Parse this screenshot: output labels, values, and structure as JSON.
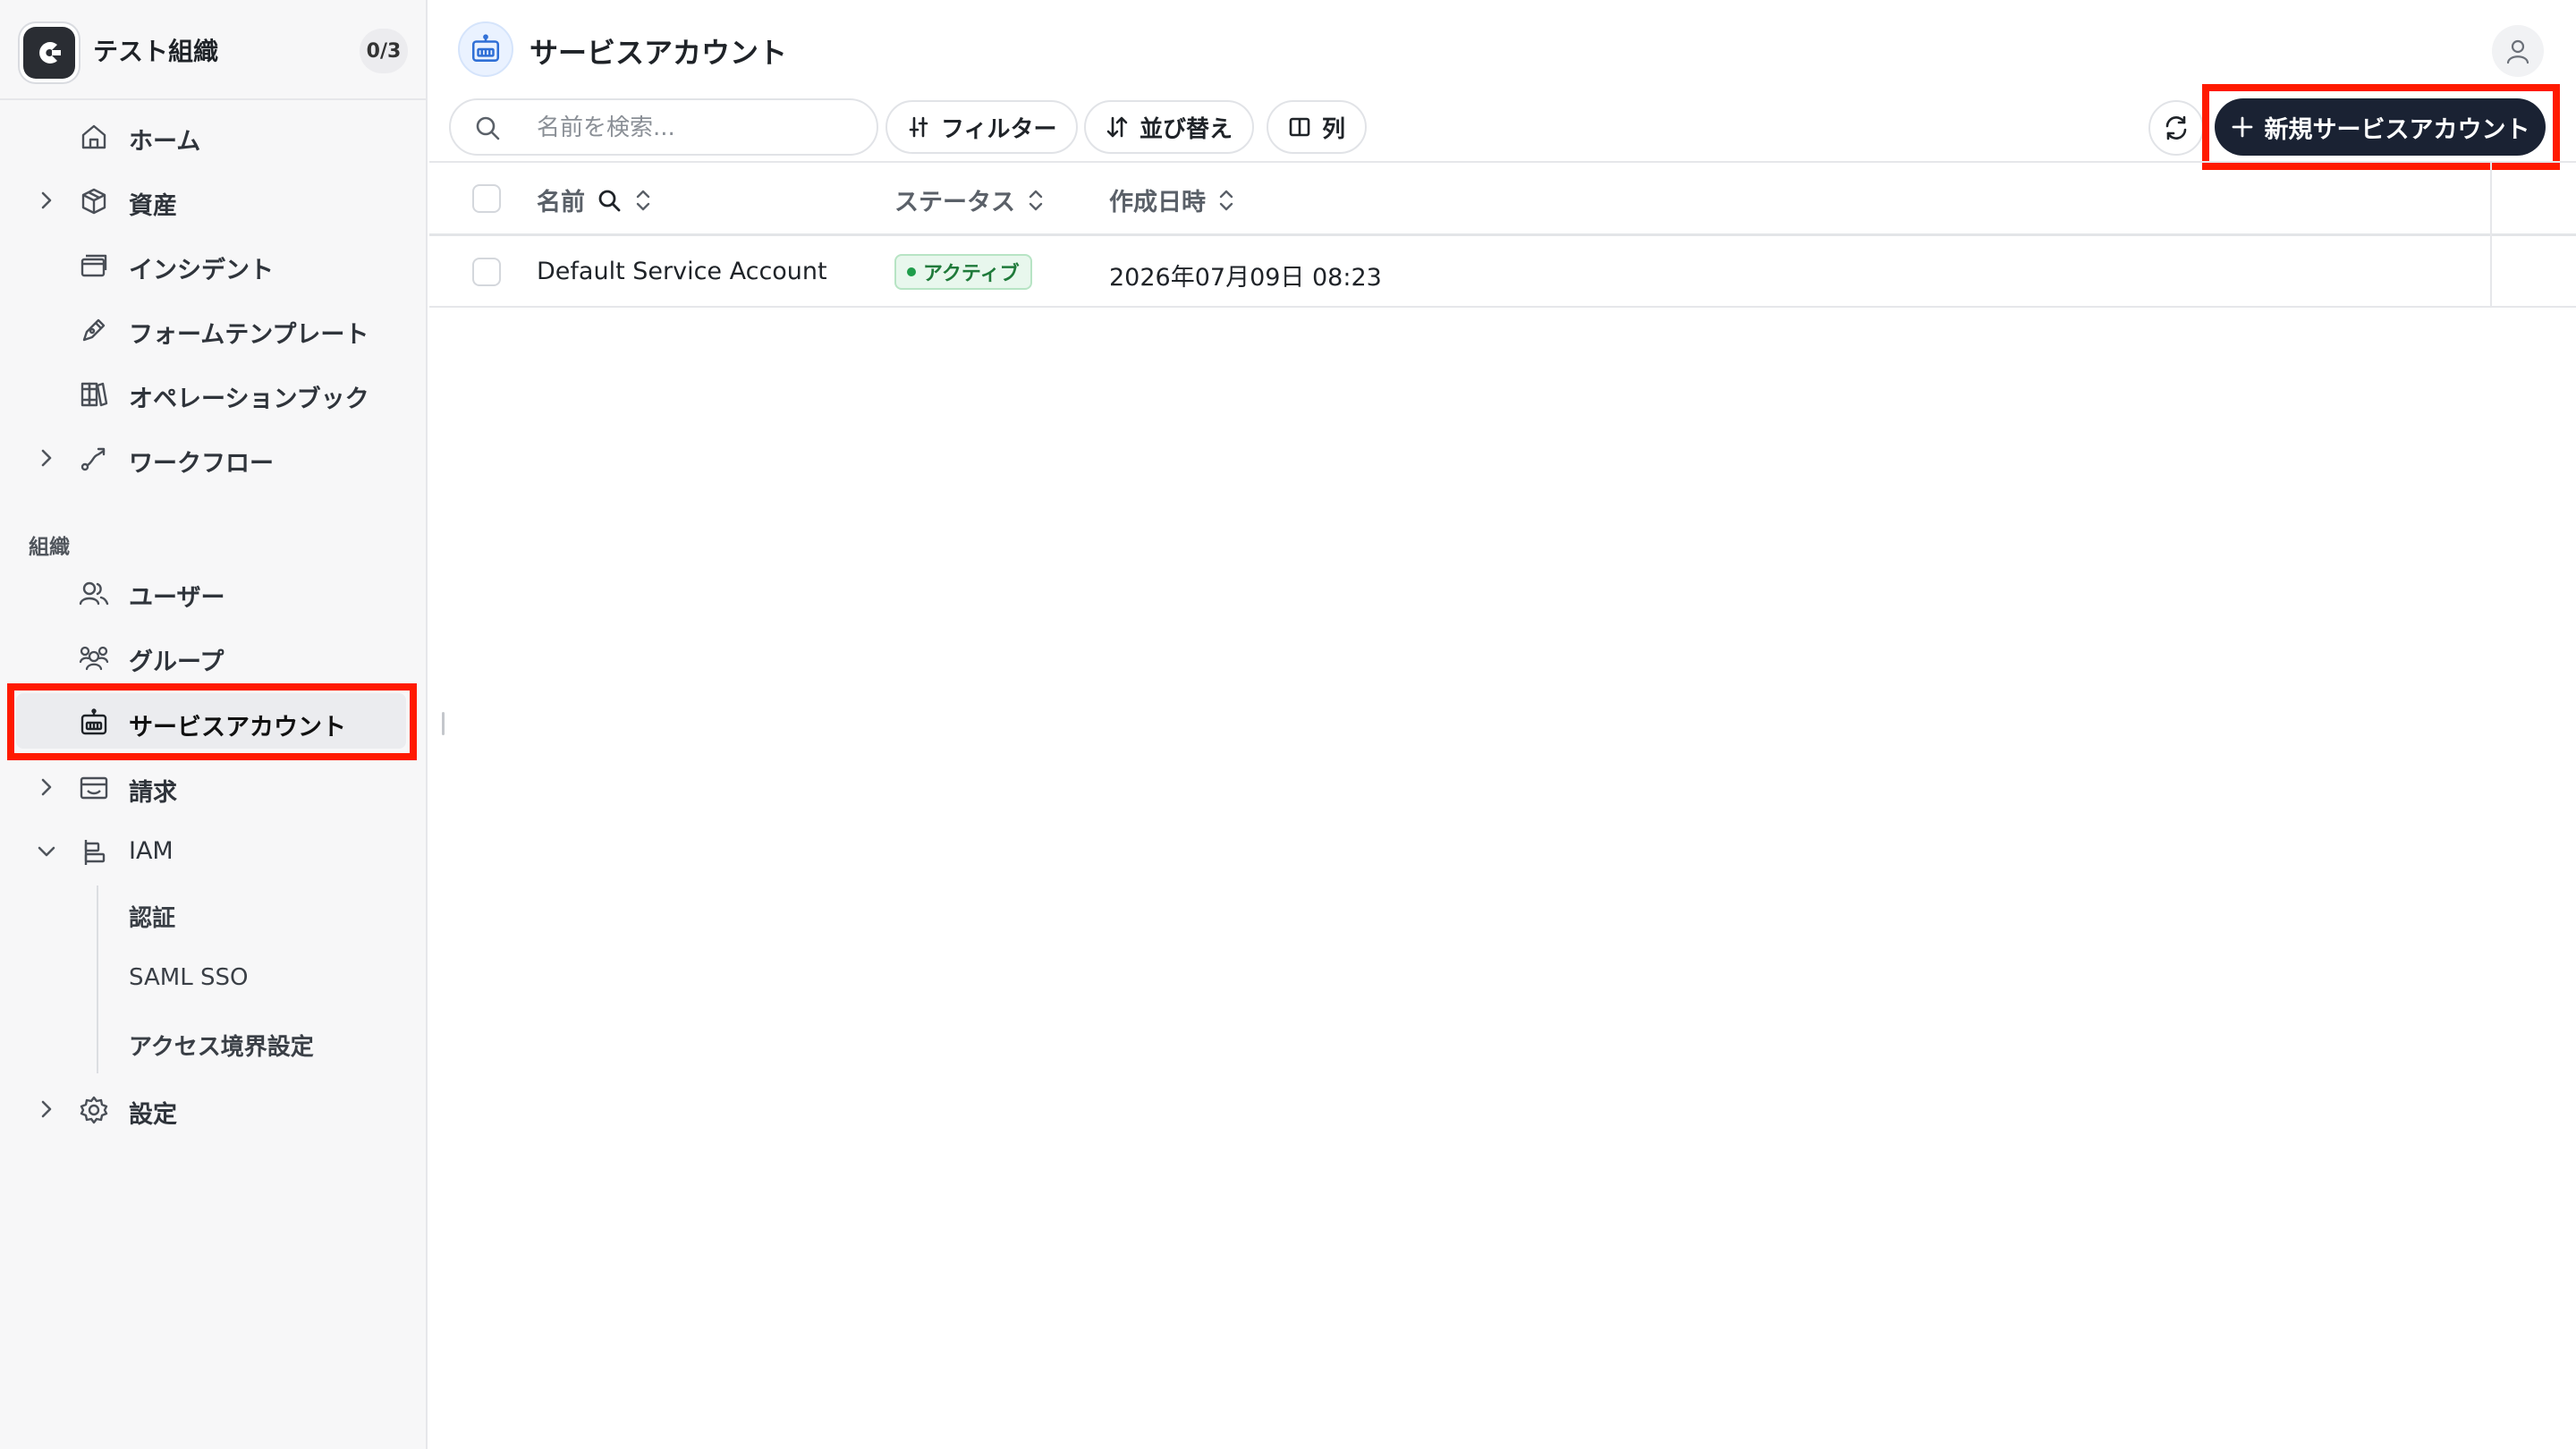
{
  "org": {
    "name": "テスト組織",
    "count": "0/3"
  },
  "sidebar": {
    "items": [
      {
        "label": "ホーム"
      },
      {
        "label": "資産"
      },
      {
        "label": "インシデント"
      },
      {
        "label": "フォームテンプレート"
      },
      {
        "label": "オペレーションブック"
      },
      {
        "label": "ワークフロー"
      }
    ],
    "section_label": "組織",
    "org_items": [
      {
        "label": "ユーザー"
      },
      {
        "label": "グループ"
      },
      {
        "label": "サービスアカウント"
      },
      {
        "label": "請求"
      },
      {
        "label": "IAM"
      }
    ],
    "iam_sub": [
      {
        "label": "認証"
      },
      {
        "label": "SAML SSO"
      },
      {
        "label": "アクセス境界設定"
      }
    ],
    "settings": {
      "label": "設定"
    }
  },
  "page": {
    "title": "サービスアカウント"
  },
  "toolbar": {
    "search_placeholder": "名前を検索...",
    "filter_label": "フィルター",
    "sort_label": "並び替え",
    "columns_label": "列",
    "new_label": "新規サービスアカウント"
  },
  "table": {
    "headers": {
      "name": "名前",
      "status": "ステータス",
      "created": "作成日時"
    },
    "rows": [
      {
        "name": "Default Service Account",
        "status": "アクティブ",
        "created": "2026年07月09日 08:23"
      }
    ]
  },
  "colors": {
    "accent": "#1a2233",
    "highlight": "#ff1a00",
    "status_active": "#1f9d4b"
  }
}
